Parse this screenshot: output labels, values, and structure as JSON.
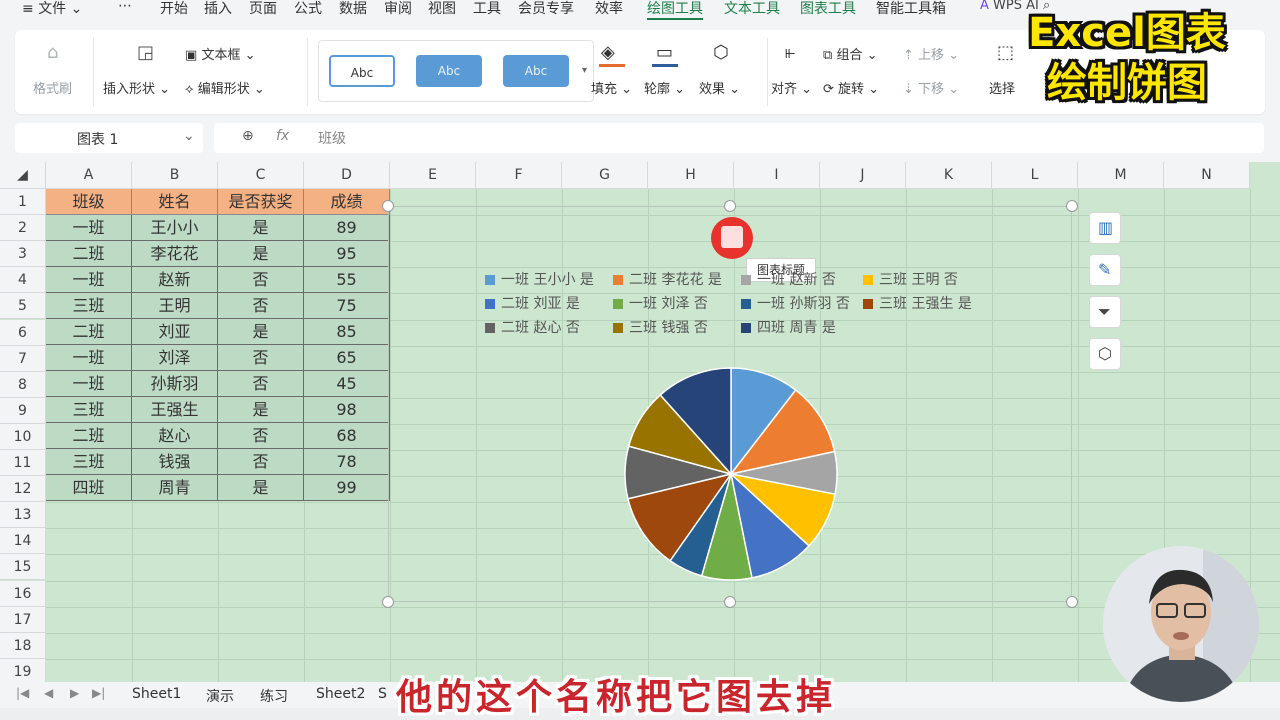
{
  "menu": {
    "items": [
      "文件",
      "⋯",
      "开始",
      "插入",
      "页面",
      "公式",
      "数据",
      "审阅",
      "视图",
      "工具",
      "会员专享",
      "效率",
      "绘图工具",
      "文本工具",
      "图表工具",
      "智能工具箱"
    ],
    "wps_ai": "WPS AI"
  },
  "ribbon": {
    "format_brush": "格式刷",
    "insert_shape": "插入形状",
    "text_box": "文本框",
    "edit_shape": "编辑形状",
    "style_labels": [
      "Abc",
      "Abc",
      "Abc"
    ],
    "fill": "填充",
    "outline": "轮廓",
    "effect": "效果",
    "align": "对齐",
    "group": "组合",
    "rotate": "旋转",
    "move_up": "上移",
    "move_down": "下移",
    "select": "选择"
  },
  "namebox": {
    "value": "图表 1"
  },
  "formula": {
    "value": "班级"
  },
  "columns": [
    "A",
    "B",
    "C",
    "D",
    "E",
    "F",
    "G",
    "H",
    "I",
    "J",
    "K",
    "L",
    "M",
    "N"
  ],
  "rows": [
    "1",
    "2",
    "3",
    "4",
    "5",
    "6",
    "7",
    "8",
    "9",
    "10",
    "11",
    "12",
    "13",
    "14",
    "15",
    "16",
    "17",
    "18",
    "19"
  ],
  "table": {
    "headers": [
      "班级",
      "姓名",
      "是否获奖",
      "成绩"
    ],
    "rows": [
      [
        "一班",
        "王小小",
        "是",
        "89"
      ],
      [
        "二班",
        "李花花",
        "是",
        "95"
      ],
      [
        "一班",
        "赵新",
        "否",
        "55"
      ],
      [
        "三班",
        "王明",
        "否",
        "75"
      ],
      [
        "二班",
        "刘亚",
        "是",
        "85"
      ],
      [
        "一班",
        "刘泽",
        "否",
        "65"
      ],
      [
        "一班",
        "孙斯羽",
        "否",
        "45"
      ],
      [
        "三班",
        "王强生",
        "是",
        "98"
      ],
      [
        "二班",
        "赵心",
        "否",
        "68"
      ],
      [
        "三班",
        "钱强",
        "否",
        "78"
      ],
      [
        "四班",
        "周青",
        "是",
        "99"
      ]
    ]
  },
  "chart_tooltip": "图表标题",
  "chart_data": {
    "type": "pie",
    "title": "",
    "categories": [
      "一班 王小小 是",
      "二班 李花花 是",
      "一班 赵新 否",
      "三班 王明 否",
      "二班 刘亚 是",
      "一班 刘泽 否",
      "一班 孙斯羽 否",
      "三班 王强生 是",
      "二班 赵心 否",
      "三班 钱强 否",
      "四班 周青 是"
    ],
    "values": [
      89,
      95,
      55,
      75,
      85,
      65,
      45,
      98,
      68,
      78,
      99
    ],
    "colors": [
      "#5b9bd5",
      "#ed7d31",
      "#a5a5a5",
      "#ffc000",
      "#4472c4",
      "#70ad47",
      "#255e91",
      "#9e480e",
      "#636363",
      "#997300",
      "#264478"
    ],
    "legend_position": "top",
    "legend_labels": [
      "一班 王小小 是",
      "二班 李花花 是",
      "一班 赵新 否",
      "三班 王明 否",
      "二班 刘亚 是",
      "一班 刘泽 否",
      "一班 孙斯羽 否",
      "三班 王强生 是",
      "二班 赵心 否",
      "三班 钱强 否",
      "四班 周青 是"
    ]
  },
  "sheet_tabs": [
    "Sheet1",
    "演示",
    "练习",
    "Sheet2",
    "S"
  ],
  "overlay": {
    "title_lines": [
      "Excel图表",
      "绘制饼图"
    ],
    "subtitle": "他的这个名称把它图去掉"
  },
  "colors": {
    "accent_green": "#1e7e4a",
    "header_orange": "#f4b183",
    "grid_green": "#cde6cf"
  }
}
